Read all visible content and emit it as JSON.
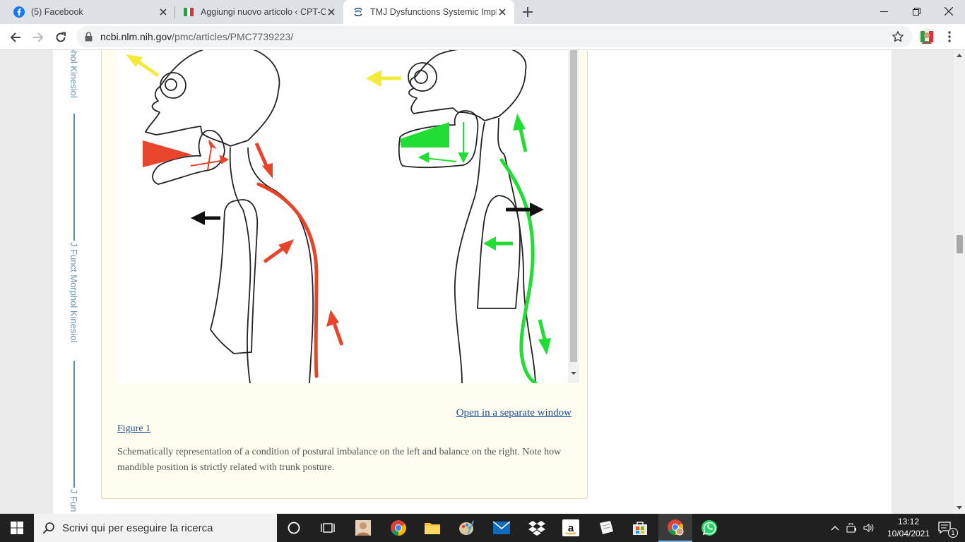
{
  "tabs": [
    {
      "title": "(5) Facebook",
      "icon": "facebook-icon"
    },
    {
      "title": "Aggiungi nuovo articolo ‹ CPT-O",
      "icon": "italy-flag-icon"
    },
    {
      "title": "TMJ Dysfunctions Systemic Impli",
      "icon": "ncbi-icon"
    }
  ],
  "address": {
    "domain": "ncbi.nlm.nih.gov",
    "path": "/pmc/articles/PMC7739223/"
  },
  "rail": {
    "text_top": "phol Kinesiol",
    "text_mid": "J Funct Morphol Kinesiol",
    "text_bottom": "J Fun"
  },
  "figure": {
    "open_link": "Open in a separate window",
    "label": "Figure 1",
    "caption": "Schematically representation of a condition of postural imbalance on the left and balance on the right. Note how mandible position is strictly related with trunk posture."
  },
  "taskbar": {
    "search_placeholder": "Scrivi qui per eseguire la ricerca",
    "time": "13:12",
    "date": "10/04/2021",
    "notification_count": "1"
  },
  "colors": {
    "imbalance": "#e8442c",
    "balance": "#22dd33",
    "head_arrow": "#f4ea3a"
  }
}
